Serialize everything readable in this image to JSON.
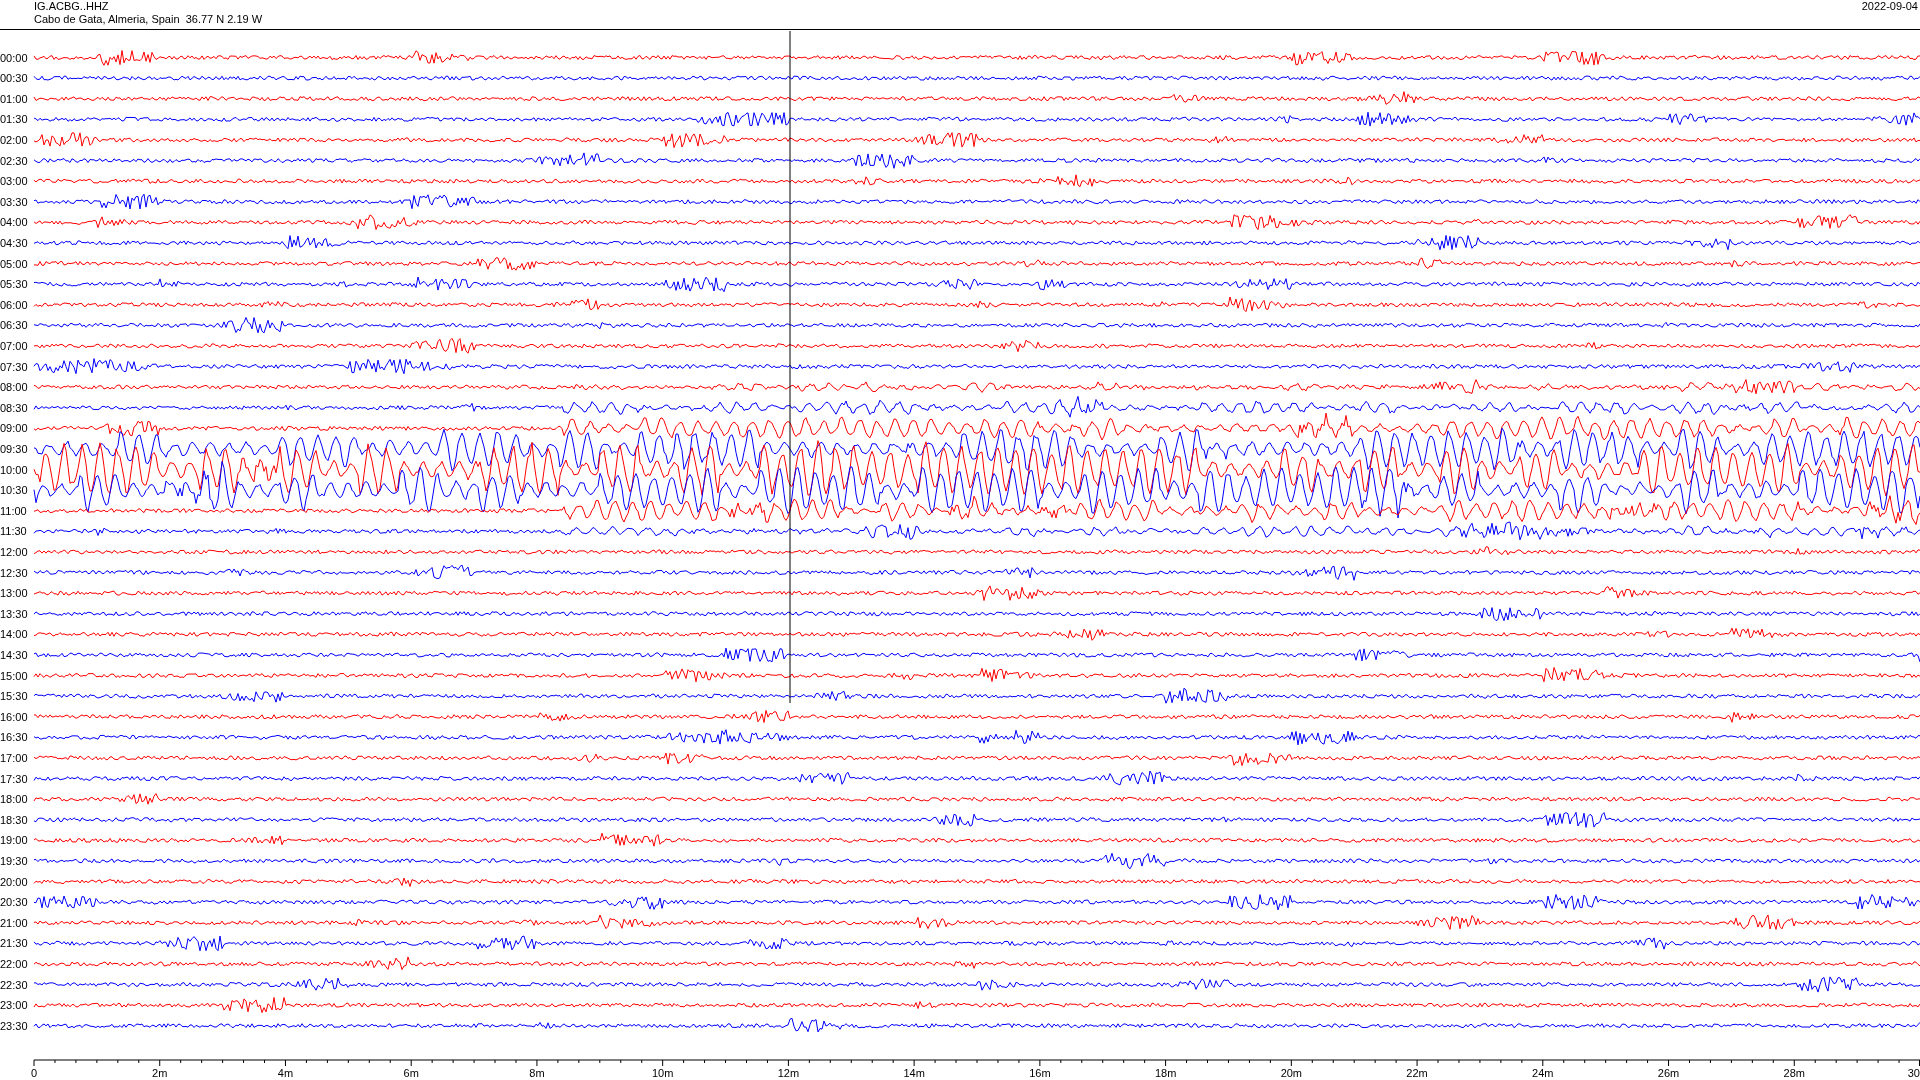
{
  "header": {
    "station": "IG.ACBG..HHZ",
    "location": "Cabo de Gata, Almeria, Spain  36.77 N 2.19 W",
    "date": "2022-09-04"
  },
  "traces": [
    {
      "time": "00:00",
      "color": "#ff0000"
    },
    {
      "time": "00:30",
      "color": "#0000ff"
    },
    {
      "time": "01:00",
      "color": "#ff0000"
    },
    {
      "time": "01:30",
      "color": "#0000ff"
    },
    {
      "time": "02:00",
      "color": "#ff0000"
    },
    {
      "time": "02:30",
      "color": "#0000ff"
    },
    {
      "time": "03:00",
      "color": "#ff0000"
    },
    {
      "time": "03:30",
      "color": "#0000ff"
    },
    {
      "time": "04:00",
      "color": "#ff0000"
    },
    {
      "time": "04:30",
      "color": "#0000ff"
    },
    {
      "time": "05:00",
      "color": "#ff0000"
    },
    {
      "time": "05:30",
      "color": "#0000ff"
    },
    {
      "time": "06:00",
      "color": "#ff0000"
    },
    {
      "time": "06:30",
      "color": "#0000ff"
    },
    {
      "time": "07:00",
      "color": "#ff0000"
    },
    {
      "time": "07:30",
      "color": "#0000ff"
    },
    {
      "time": "08:00",
      "color": "#ff0000"
    },
    {
      "time": "08:30",
      "color": "#0000ff"
    },
    {
      "time": "09:00",
      "color": "#ff0000"
    },
    {
      "time": "09:30",
      "color": "#0000ff"
    },
    {
      "time": "10:00",
      "color": "#ff0000"
    },
    {
      "time": "10:30",
      "color": "#0000ff"
    },
    {
      "time": "11:00",
      "color": "#ff0000"
    },
    {
      "time": "11:30",
      "color": "#0000ff"
    },
    {
      "time": "12:00",
      "color": "#ff0000"
    },
    {
      "time": "12:30",
      "color": "#0000ff"
    },
    {
      "time": "13:00",
      "color": "#ff0000"
    },
    {
      "time": "13:30",
      "color": "#0000ff"
    },
    {
      "time": "14:00",
      "color": "#ff0000"
    },
    {
      "time": "14:30",
      "color": "#0000ff"
    },
    {
      "time": "15:00",
      "color": "#ff0000"
    },
    {
      "time": "15:30",
      "color": "#0000ff"
    },
    {
      "time": "16:00",
      "color": "#ff0000"
    },
    {
      "time": "16:30",
      "color": "#0000ff"
    },
    {
      "time": "17:00",
      "color": "#ff0000"
    },
    {
      "time": "17:30",
      "color": "#0000ff"
    },
    {
      "time": "18:00",
      "color": "#ff0000"
    },
    {
      "time": "18:30",
      "color": "#0000ff"
    },
    {
      "time": "19:00",
      "color": "#ff0000"
    },
    {
      "time": "19:30",
      "color": "#0000ff"
    },
    {
      "time": "20:00",
      "color": "#ff0000"
    },
    {
      "time": "20:30",
      "color": "#0000ff"
    },
    {
      "time": "21:00",
      "color": "#ff0000"
    },
    {
      "time": "21:30",
      "color": "#0000ff"
    },
    {
      "time": "22:00",
      "color": "#ff0000"
    },
    {
      "time": "22:30",
      "color": "#0000ff"
    },
    {
      "time": "23:00",
      "color": "#ff0000"
    },
    {
      "time": "23:30",
      "color": "#0000ff"
    }
  ],
  "axis": {
    "ticks": [
      "0",
      "2m",
      "4m",
      "6m",
      "8m",
      "10m",
      "12m",
      "14m",
      "16m",
      "18m",
      "20m",
      "22m",
      "24m",
      "26m",
      "28m",
      "30"
    ]
  }
}
